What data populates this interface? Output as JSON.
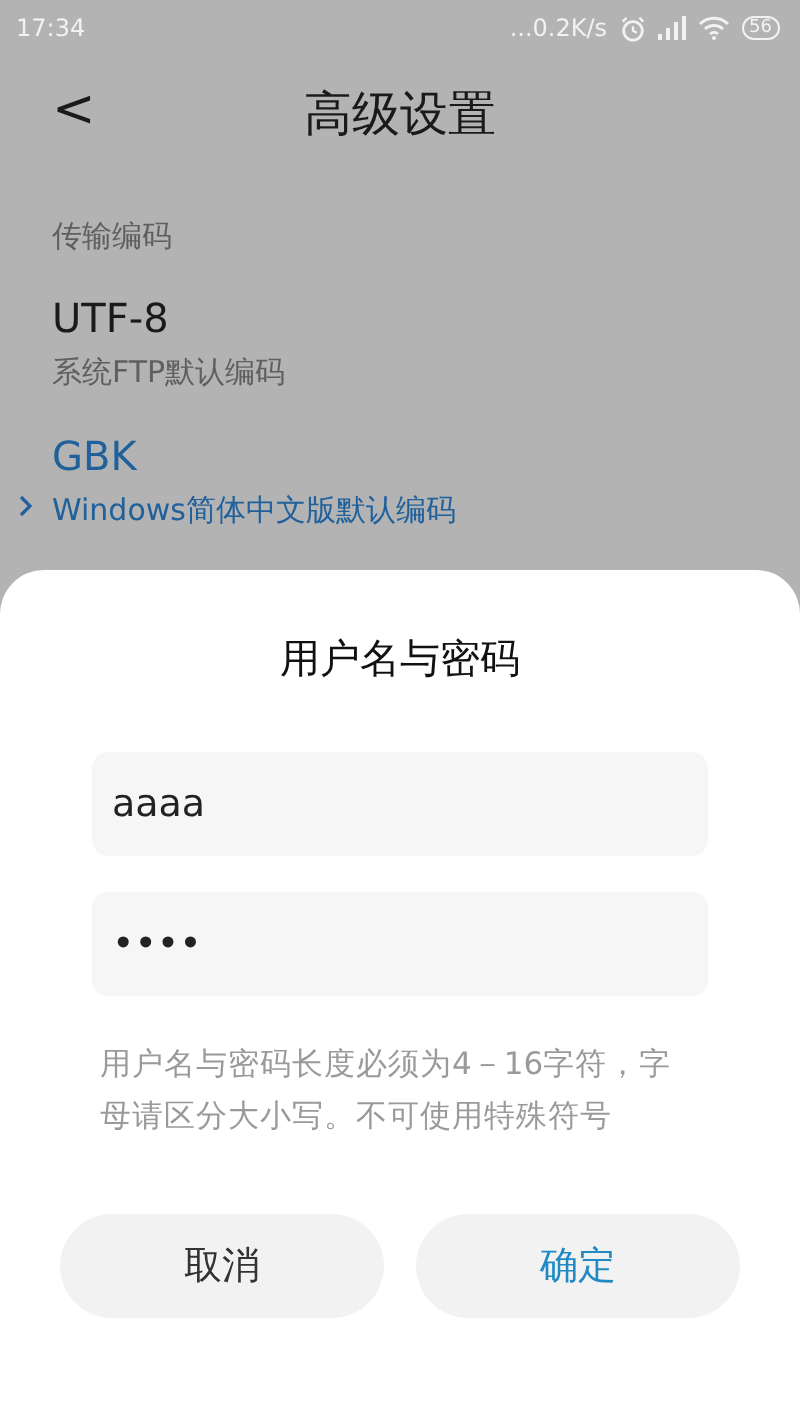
{
  "status_bar": {
    "time": "17:34",
    "speed": "...0.2K/s",
    "battery": "56"
  },
  "header": {
    "back": "<",
    "title": "高级设置"
  },
  "section": {
    "label": "传输编码",
    "items": [
      {
        "name": "UTF-8",
        "description": "系统FTP默认编码",
        "selected": false
      },
      {
        "name": "GBK",
        "description": "Windows简体中文版默认编码",
        "selected": true
      }
    ]
  },
  "dialog": {
    "title": "用户名与密码",
    "username": {
      "value": "aaaa"
    },
    "password": {
      "value": "••••"
    },
    "hint": "用户名与密码长度必须为4－16字符，字母请区分大小写。不可使用特殊符号",
    "buttons": [
      {
        "label": "取消",
        "kind": "cancel"
      },
      {
        "label": "确定",
        "kind": "confirm"
      }
    ]
  }
}
